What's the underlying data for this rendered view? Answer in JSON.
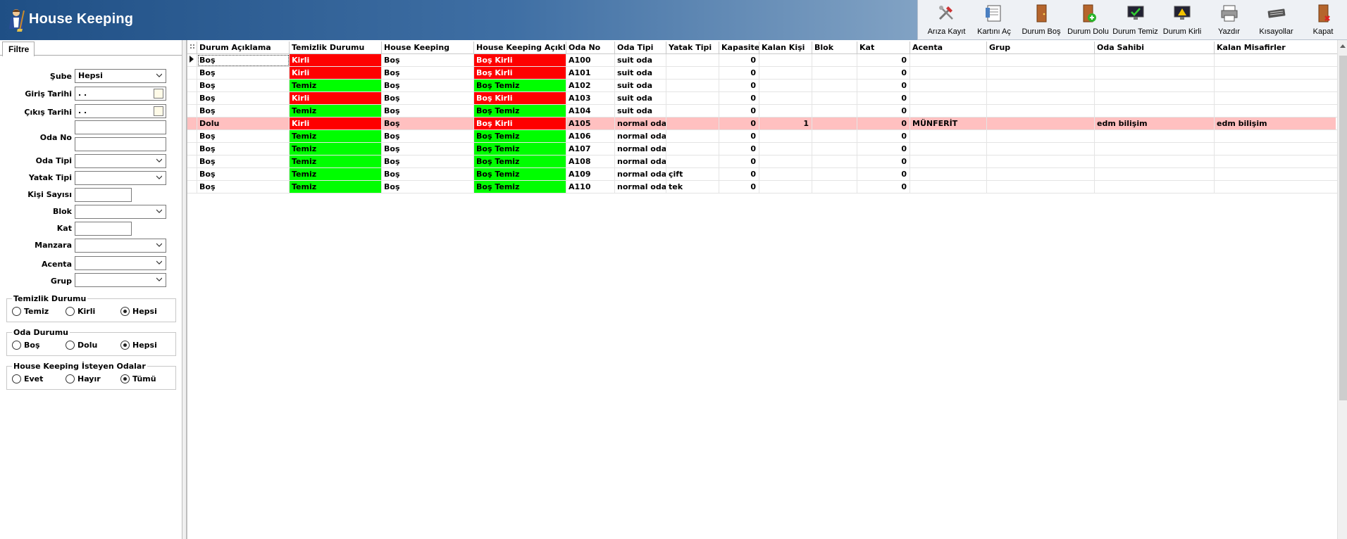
{
  "app": {
    "title": "House Keeping"
  },
  "colors": {
    "dirty": "#fe0000",
    "clean": "#00fe00",
    "occupied_row": "#ffc0c0",
    "header_start": "#1f4f85"
  },
  "toolbar": [
    {
      "label": "Arıza Kayıt",
      "icon": "tools-icon"
    },
    {
      "label": "Kartını Aç",
      "icon": "card-icon"
    },
    {
      "label": "Durum Boş",
      "icon": "door-icon"
    },
    {
      "label": "Durum Dolu",
      "icon": "door-plus-icon"
    },
    {
      "label": "Durum Temiz",
      "icon": "monitor-check-icon"
    },
    {
      "label": "Durum Kirli",
      "icon": "monitor-warning-icon"
    },
    {
      "label": "Yazdır",
      "icon": "printer-icon"
    },
    {
      "label": "Kısayollar",
      "icon": "keyboard-icon"
    },
    {
      "label": "Kapat",
      "icon": "exit-door-icon"
    }
  ],
  "filter": {
    "tab": "Filtre",
    "sube": {
      "label": "Şube",
      "value": "Hepsi"
    },
    "giris": {
      "label": "Giriş Tarihi",
      "value": " . ."
    },
    "cikis": {
      "label": "Çıkış Tarihi",
      "value": " . ."
    },
    "odano": {
      "label": "Oda No",
      "value": ""
    },
    "odatipi": {
      "label": "Oda Tipi",
      "value": ""
    },
    "yatak": {
      "label": "Yatak Tipi",
      "value": ""
    },
    "kisi": {
      "label": "Kişi Sayısı",
      "value": ""
    },
    "blok": {
      "label": "Blok",
      "value": ""
    },
    "kat": {
      "label": "Kat",
      "value": ""
    },
    "manzara": {
      "label": "Manzara",
      "value": ""
    },
    "acenta": {
      "label": "Acenta",
      "value": ""
    },
    "grup": {
      "label": "Grup",
      "value": ""
    },
    "temizlik": {
      "title": "Temizlik Durumu",
      "options": [
        "Temiz",
        "Kirli",
        "Hepsi"
      ],
      "selected": 2
    },
    "oda": {
      "title": "Oda Durumu",
      "options": [
        "Boş",
        "Dolu",
        "Hepsi"
      ],
      "selected": 2
    },
    "hk": {
      "title": "House Keeping İsteyen Odalar",
      "options": [
        "Evet",
        "Hayır",
        "Tümü"
      ],
      "selected": 2
    }
  },
  "grid": {
    "columns": [
      "Durum Açıklama",
      "Temizlik Durumu",
      "House Keeping",
      "House Keeping Açıkl...",
      "Oda No",
      "Oda Tipi",
      "Yatak Tipi",
      "Kapasite",
      "Kalan Kişi",
      "Blok",
      "Kat",
      "Acenta",
      "Grup",
      "Oda Sahibi",
      "Kalan Misafirler"
    ],
    "rows": [
      [
        "Boş",
        "Kirli",
        "Boş",
        "Boş Kirli",
        "A100",
        "suit oda",
        "",
        "0",
        "",
        "",
        "0",
        "",
        "",
        "",
        ""
      ],
      [
        "Boş",
        "Kirli",
        "Boş",
        "Boş Kirli",
        "A101",
        "suit oda",
        "",
        "0",
        "",
        "",
        "0",
        "",
        "",
        "",
        ""
      ],
      [
        "Boş",
        "Temiz",
        "Boş",
        "Boş Temiz",
        "A102",
        "suit oda",
        "",
        "0",
        "",
        "",
        "0",
        "",
        "",
        "",
        ""
      ],
      [
        "Boş",
        "Kirli",
        "Boş",
        "Boş Kirli",
        "A103",
        "suit oda",
        "",
        "0",
        "",
        "",
        "0",
        "",
        "",
        "",
        ""
      ],
      [
        "Boş",
        "Temiz",
        "Boş",
        "Boş Temiz",
        "A104",
        "suit oda",
        "",
        "0",
        "",
        "",
        "0",
        "",
        "",
        "",
        ""
      ],
      [
        "Dolu",
        "Kirli",
        "Boş",
        "Boş Kirli",
        "A105",
        "normal oda",
        "",
        "0",
        "1",
        "",
        "0",
        "MÜNFERİT",
        "",
        "edm bilişim",
        "edm bilişim"
      ],
      [
        "Boş",
        "Temiz",
        "Boş",
        "Boş Temiz",
        "A106",
        "normal oda",
        "",
        "0",
        "",
        "",
        "0",
        "",
        "",
        "",
        ""
      ],
      [
        "Boş",
        "Temiz",
        "Boş",
        "Boş Temiz",
        "A107",
        "normal oda",
        "",
        "0",
        "",
        "",
        "0",
        "",
        "",
        "",
        ""
      ],
      [
        "Boş",
        "Temiz",
        "Boş",
        "Boş Temiz",
        "A108",
        "normal oda",
        "",
        "0",
        "",
        "",
        "0",
        "",
        "",
        "",
        ""
      ],
      [
        "Boş",
        "Temiz",
        "Boş",
        "Boş Temiz",
        "A109",
        "normal oda",
        "çift",
        "0",
        "",
        "",
        "0",
        "",
        "",
        "",
        ""
      ],
      [
        "Boş",
        "Temiz",
        "Boş",
        "Boş Temiz",
        "A110",
        "normal oda",
        "tek",
        "0",
        "",
        "",
        "0",
        "",
        "",
        "",
        ""
      ]
    ]
  }
}
